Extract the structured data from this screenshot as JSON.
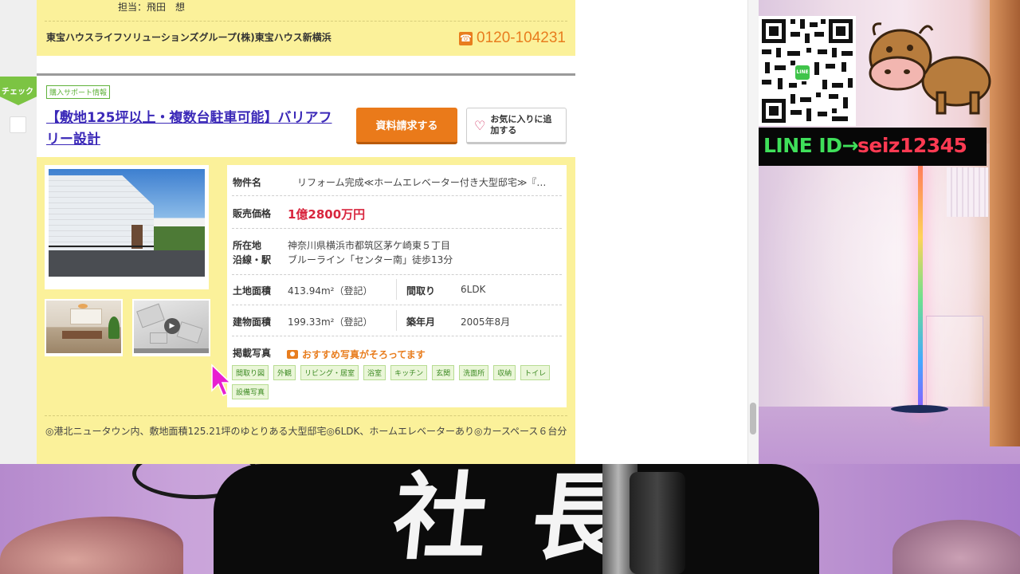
{
  "prev_listing": {
    "person": "担当：飛田　想",
    "company": "東宝ハウスライフソリューションズグループ(株)東宝ハウス新横浜",
    "phone": "0120-104231"
  },
  "listing": {
    "check_label": "チェック",
    "badge": "購入サポート情報",
    "title": "【敷地125坪以上・複数台駐車可能】バリアフリー設計",
    "request_button": "資料請求する",
    "favorite_button": "お気に入りに追加する",
    "rows": {
      "name_label": "物件名",
      "name_value": "リフォーム完成≪ホームエレベーター付き大型邸宅≫『…",
      "price_label": "販売価格",
      "price_value": "1億2800万円",
      "location_label": "所在地",
      "location_value": "神奈川県横浜市都筑区茅ケ崎東５丁目",
      "line_label": "沿線・駅",
      "line_value": "ブルーライン「センター南」徒歩13分",
      "land_label": "土地面積",
      "land_value": "413.94m²（登記）",
      "layout_label": "間取り",
      "layout_value": "6LDK",
      "building_label": "建物面積",
      "building_value": "199.33m²（登記）",
      "built_label": "築年月",
      "built_value": "2005年8月",
      "photos_label": "掲載写真",
      "photos_note": "おすすめ写真がそろってます"
    },
    "photo_tags": [
      "間取り図",
      "外観",
      "リビング・居室",
      "浴室",
      "キッチン",
      "玄関",
      "洗面所",
      "収納",
      "トイレ",
      "設備写真"
    ],
    "description": "◎港北ニュータウン内、敷地面積125.21坪のゆとりある大型邸宅◎6LDK、ホームエレベーターあり◎カースペース６台分"
  },
  "stream_overlay": {
    "line_id_label": "LINE ID→",
    "line_id_value": "seiz12345",
    "line_badge": "LINE",
    "shirt_text": "社長"
  },
  "colors": {
    "card_yellow": "#fbf19a",
    "accent_orange": "#ea7a1a",
    "link_purple": "#3b29b8",
    "price_red": "#d8263e",
    "tag_green": "#3c8a22",
    "line_green": "#3fe05a",
    "line_red": "#ff3a52"
  }
}
